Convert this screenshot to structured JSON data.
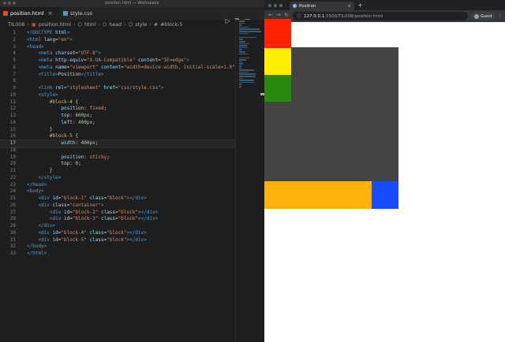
{
  "vscode": {
    "window_title": "position.html — Workspace",
    "tabs": [
      {
        "label": "position.html",
        "active": true,
        "icon": "html-file-icon",
        "color": "#e44d26"
      },
      {
        "label": "style.css",
        "active": false,
        "icon": "css-file-icon",
        "color": "#519aba"
      }
    ],
    "breadcrumb": [
      "TIL008",
      "position.html",
      "html",
      "head",
      "style",
      "#block-5"
    ],
    "current_line": 17,
    "lines": [
      {
        "n": "1",
        "tokens": [
          [
            "t-doc",
            "<!DOCTYPE "
          ],
          [
            "t-attr",
            "html"
          ],
          [
            "t-doc",
            ">"
          ]
        ]
      },
      {
        "n": "2",
        "tokens": [
          [
            "t-tag",
            "<html "
          ],
          [
            "t-attr",
            "lang"
          ],
          [
            "t-txt",
            "="
          ],
          [
            "t-str",
            "\"en\""
          ],
          [
            "t-tag",
            ">"
          ]
        ]
      },
      {
        "n": "3",
        "tokens": [
          [
            "t-tag",
            "<head>"
          ]
        ]
      },
      {
        "n": "4",
        "tokens": [
          [
            "t-txt",
            "    "
          ],
          [
            "t-tag",
            "<meta "
          ],
          [
            "t-attr",
            "charset"
          ],
          [
            "t-txt",
            "="
          ],
          [
            "t-str",
            "\"UTF-8\""
          ],
          [
            "t-tag",
            ">"
          ]
        ]
      },
      {
        "n": "5",
        "tokens": [
          [
            "t-txt",
            "    "
          ],
          [
            "t-tag",
            "<meta "
          ],
          [
            "t-attr",
            "http-equiv"
          ],
          [
            "t-txt",
            "="
          ],
          [
            "t-str",
            "\"X-UA-Compatible\""
          ],
          [
            "t-txt",
            " "
          ],
          [
            "t-attr",
            "content"
          ],
          [
            "t-txt",
            "="
          ],
          [
            "t-str",
            "\"IE=edge\""
          ],
          [
            "t-tag",
            ">"
          ]
        ]
      },
      {
        "n": "6",
        "tokens": [
          [
            "t-txt",
            "    "
          ],
          [
            "t-tag",
            "<meta "
          ],
          [
            "t-attr",
            "name"
          ],
          [
            "t-txt",
            "="
          ],
          [
            "t-str",
            "\"viewport\""
          ],
          [
            "t-txt",
            " "
          ],
          [
            "t-attr",
            "content"
          ],
          [
            "t-txt",
            "="
          ],
          [
            "t-str",
            "\"width=device-width, initial-scale=1.0\""
          ],
          [
            "t-tag",
            ">"
          ]
        ]
      },
      {
        "n": "7",
        "tokens": [
          [
            "t-txt",
            "    "
          ],
          [
            "t-tag",
            "<title>"
          ],
          [
            "t-txt",
            "Position"
          ],
          [
            "t-tag",
            "</title>"
          ]
        ]
      },
      {
        "n": "8",
        "tokens": []
      },
      {
        "n": "9",
        "tokens": [
          [
            "t-txt",
            "    "
          ],
          [
            "t-tag",
            "<link "
          ],
          [
            "t-attr",
            "rel"
          ],
          [
            "t-txt",
            "="
          ],
          [
            "t-str",
            "\"stylesheet\""
          ],
          [
            "t-txt",
            " "
          ],
          [
            "t-attr",
            "href"
          ],
          [
            "t-txt",
            "="
          ],
          [
            "t-str",
            "\"css/style.css\""
          ],
          [
            "t-tag",
            ">"
          ]
        ]
      },
      {
        "n": "10",
        "tokens": [
          [
            "t-txt",
            "    "
          ],
          [
            "t-tag",
            "<style>"
          ]
        ]
      },
      {
        "n": "11",
        "tokens": [
          [
            "t-txt",
            "        "
          ],
          [
            "t-sel",
            "#block-4"
          ],
          [
            "t-txt",
            " {"
          ]
        ]
      },
      {
        "n": "12",
        "tokens": [
          [
            "t-txt",
            "            "
          ],
          [
            "t-prop",
            "position"
          ],
          [
            "t-txt",
            ": "
          ],
          [
            "t-kw",
            "fixed"
          ],
          [
            "t-txt",
            ";"
          ]
        ]
      },
      {
        "n": "13",
        "tokens": [
          [
            "t-txt",
            "            "
          ],
          [
            "t-prop",
            "top"
          ],
          [
            "t-txt",
            ": "
          ],
          [
            "t-val",
            "600px"
          ],
          [
            "t-txt",
            ";"
          ]
        ]
      },
      {
        "n": "14",
        "tokens": [
          [
            "t-txt",
            "            "
          ],
          [
            "t-prop",
            "left"
          ],
          [
            "t-txt",
            ": "
          ],
          [
            "t-val",
            "400px"
          ],
          [
            "t-txt",
            ";"
          ]
        ]
      },
      {
        "n": "15",
        "tokens": [
          [
            "t-txt",
            "        }"
          ]
        ]
      },
      {
        "n": "16",
        "tokens": [
          [
            "t-txt",
            "        "
          ],
          [
            "t-sel",
            "#block-5"
          ],
          [
            "t-txt",
            " {"
          ]
        ]
      },
      {
        "n": "17",
        "tokens": [
          [
            "t-txt",
            "            "
          ],
          [
            "t-prop",
            "width"
          ],
          [
            "t-txt",
            ": "
          ],
          [
            "t-val",
            "400px"
          ],
          [
            "t-txt",
            ";"
          ]
        ]
      },
      {
        "n": "18",
        "tokens": []
      },
      {
        "n": "19",
        "tokens": [
          [
            "t-txt",
            "            "
          ],
          [
            "t-prop",
            "position"
          ],
          [
            "t-txt",
            ": "
          ],
          [
            "t-kw",
            "sticky"
          ],
          [
            "t-txt",
            ";"
          ]
        ]
      },
      {
        "n": "20",
        "tokens": [
          [
            "t-txt",
            "            "
          ],
          [
            "t-prop",
            "top"
          ],
          [
            "t-txt",
            ": "
          ],
          [
            "t-val",
            "0"
          ],
          [
            "t-txt",
            ";"
          ]
        ]
      },
      {
        "n": "21",
        "tokens": [
          [
            "t-txt",
            "        }"
          ]
        ]
      },
      {
        "n": "22",
        "tokens": [
          [
            "t-txt",
            "    "
          ],
          [
            "t-tag",
            "</style>"
          ]
        ]
      },
      {
        "n": "23",
        "tokens": [
          [
            "t-tag",
            "</head>"
          ]
        ]
      },
      {
        "n": "24",
        "tokens": [
          [
            "t-tag",
            "<body>"
          ]
        ]
      },
      {
        "n": "25",
        "tokens": [
          [
            "t-txt",
            "    "
          ],
          [
            "t-tag",
            "<div "
          ],
          [
            "t-attr",
            "id"
          ],
          [
            "t-txt",
            "="
          ],
          [
            "t-str",
            "\"block-1\""
          ],
          [
            "t-txt",
            " "
          ],
          [
            "t-attr",
            "class"
          ],
          [
            "t-txt",
            "="
          ],
          [
            "t-str",
            "\"block\""
          ],
          [
            "t-tag",
            "></div>"
          ]
        ]
      },
      {
        "n": "26",
        "tokens": [
          [
            "t-txt",
            "    "
          ],
          [
            "t-tag",
            "<div "
          ],
          [
            "t-attr",
            "class"
          ],
          [
            "t-txt",
            "="
          ],
          [
            "t-str",
            "\"container\""
          ],
          [
            "t-tag",
            ">"
          ]
        ]
      },
      {
        "n": "27",
        "tokens": [
          [
            "t-txt",
            "        "
          ],
          [
            "t-tag",
            "<div "
          ],
          [
            "t-attr",
            "id"
          ],
          [
            "t-txt",
            "="
          ],
          [
            "t-str",
            "\"block-2\""
          ],
          [
            "t-txt",
            " "
          ],
          [
            "t-attr",
            "class"
          ],
          [
            "t-txt",
            "="
          ],
          [
            "t-str",
            "\"block\""
          ],
          [
            "t-tag",
            "></div>"
          ]
        ]
      },
      {
        "n": "28",
        "tokens": [
          [
            "t-txt",
            "        "
          ],
          [
            "t-tag",
            "<div "
          ],
          [
            "t-attr",
            "id"
          ],
          [
            "t-txt",
            "="
          ],
          [
            "t-str",
            "\"block-3\""
          ],
          [
            "t-txt",
            " "
          ],
          [
            "t-attr",
            "class"
          ],
          [
            "t-txt",
            "="
          ],
          [
            "t-str",
            "\"block\""
          ],
          [
            "t-tag",
            "></div>"
          ]
        ]
      },
      {
        "n": "29",
        "tokens": [
          [
            "t-txt",
            "    "
          ],
          [
            "t-tag",
            "</div>"
          ]
        ]
      },
      {
        "n": "30",
        "tokens": [
          [
            "t-txt",
            "    "
          ],
          [
            "t-tag",
            "<div "
          ],
          [
            "t-attr",
            "id"
          ],
          [
            "t-txt",
            "="
          ],
          [
            "t-str",
            "\"block-4\""
          ],
          [
            "t-txt",
            " "
          ],
          [
            "t-attr",
            "class"
          ],
          [
            "t-txt",
            "="
          ],
          [
            "t-str",
            "\"block\""
          ],
          [
            "t-tag",
            "></div>"
          ]
        ]
      },
      {
        "n": "31",
        "tokens": [
          [
            "t-txt",
            "    "
          ],
          [
            "t-tag",
            "<div "
          ],
          [
            "t-attr",
            "id"
          ],
          [
            "t-txt",
            "="
          ],
          [
            "t-str",
            "\"block-5\""
          ],
          [
            "t-txt",
            " "
          ],
          [
            "t-attr",
            "class"
          ],
          [
            "t-txt",
            "="
          ],
          [
            "t-str",
            "\"block\""
          ],
          [
            "t-tag",
            "></div>"
          ]
        ]
      },
      {
        "n": "32",
        "tokens": [
          [
            "t-tag",
            "</body>"
          ]
        ]
      },
      {
        "n": "33",
        "tokens": [
          [
            "t-tag",
            "</html>"
          ]
        ]
      }
    ]
  },
  "browser": {
    "tab_title": "Position",
    "url_host": "127.0.0.1",
    "url_path": ":5500/TIL008/position.html",
    "profile_label": "Guest",
    "blocks": {
      "block_1": {
        "color": "#ff2200"
      },
      "container": {
        "color": "#444444"
      },
      "block_2": {
        "color": "#ffee00"
      },
      "block_3": {
        "color": "#2a8a10"
      },
      "block_4": {
        "color": "#1a4cff"
      },
      "block_5": {
        "color": "#ffb20e"
      }
    }
  }
}
